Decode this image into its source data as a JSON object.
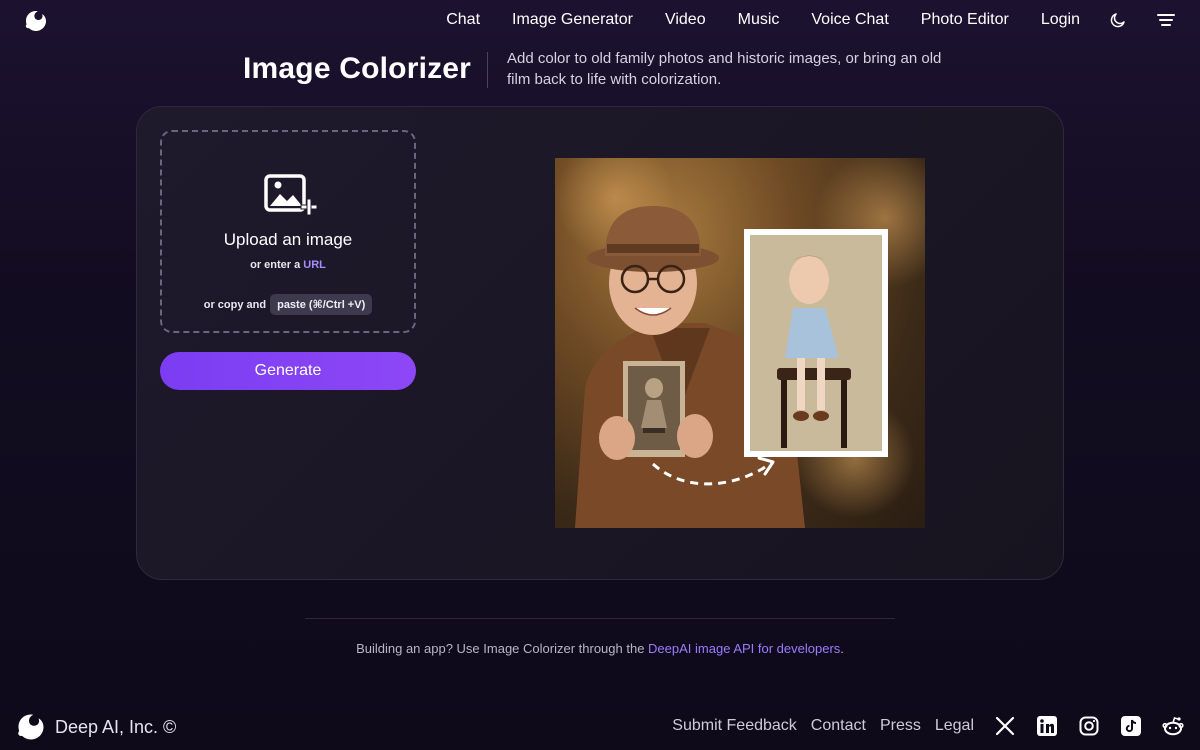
{
  "nav": {
    "items": [
      "Chat",
      "Image Generator",
      "Video",
      "Music",
      "Voice Chat",
      "Photo Editor",
      "Login"
    ],
    "theme_icon": "moon-icon",
    "menu_icon": "menu-icon"
  },
  "header": {
    "title": "Image Colorizer",
    "description": "Add color to old family photos and historic images, or bring an old film back to life with colorization."
  },
  "upload": {
    "icon": "image-add-icon",
    "title": "Upload an image",
    "url_prefix": "or enter a",
    "url_link": "URL",
    "paste_prefix": "or copy and",
    "paste_chip": "paste (⌘/Ctrl +V)"
  },
  "generate_label": "Generate",
  "footer": {
    "api_text": "Building an app? Use Image Colorizer through the",
    "api_link": "DeepAI image API for developers",
    "api_suffix": ".",
    "brand": "Deep AI, Inc. ©",
    "links": [
      "Submit Feedback",
      "Contact",
      "Press",
      "Legal"
    ],
    "social_icons": [
      "x-icon",
      "linkedin-icon",
      "instagram-icon",
      "tiktok-icon",
      "reddit-icon"
    ]
  },
  "colors": {
    "accent": "#8d47f6",
    "link": "#9b7bff",
    "background": "#120c20"
  }
}
